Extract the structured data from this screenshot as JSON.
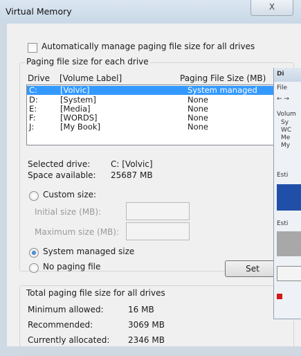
{
  "window": {
    "title": "Virtual Memory",
    "close_glyph": "X"
  },
  "auto_manage": {
    "label": "Automatically manage paging file size for all drives",
    "checked": false
  },
  "paging_group": {
    "title": "Paging file size for each drive",
    "columns": [
      "Drive",
      "[Volume Label]",
      "Paging File Size (MB)"
    ],
    "rows": [
      {
        "drive": "C:",
        "label": "[Volvic]",
        "size": "System managed",
        "selected": true
      },
      {
        "drive": "D:",
        "label": "[System]",
        "size": "None",
        "selected": false
      },
      {
        "drive": "E:",
        "label": "[Media]",
        "size": "None",
        "selected": false
      },
      {
        "drive": "F:",
        "label": "[WORDS]",
        "size": "None",
        "selected": false
      },
      {
        "drive": "J:",
        "label": "[My Book]",
        "size": "None",
        "selected": false
      }
    ],
    "selected_drive_label": "Selected drive:",
    "selected_drive_value": "C:  [Volvic]",
    "space_label": "Space available:",
    "space_value": "25687 MB",
    "custom_size_label": "Custom size:",
    "initial_size_label": "Initial size (MB):",
    "initial_size_value": "",
    "maximum_size_label": "Maximum size (MB):",
    "maximum_size_value": "",
    "system_managed_label": "System managed size",
    "no_paging_label": "No paging file",
    "selected_option": "system_managed",
    "set_button": "Set"
  },
  "total_group": {
    "title": "Total paging file size for all drives",
    "minimum_label": "Minimum allowed:",
    "minimum_value": "16 MB",
    "recommended_label": "Recommended:",
    "recommended_value": "3069 MB",
    "allocated_label": "Currently allocated:",
    "allocated_value": "2346 MB"
  },
  "background_window": {
    "title_fragment": "Di",
    "menu_fragment": "File",
    "nav_fragment": "← →",
    "list_header": "Volum",
    "items": [
      "Sy",
      "WC",
      "Me",
      "My"
    ],
    "labels": [
      "Esti",
      "Esti"
    ],
    "colors": {
      "blue_block": "#1f4fa8",
      "gray_block": "#a8a8a8",
      "red_marker": "#d01818"
    }
  }
}
